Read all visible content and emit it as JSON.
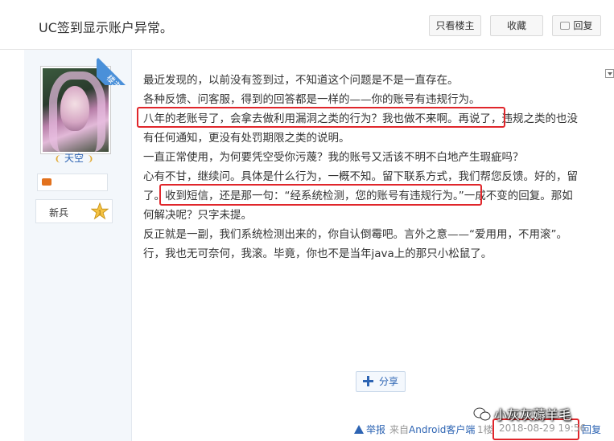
{
  "thread": {
    "title": "UC签到显示账户异常。",
    "buttons": {
      "only_op": "只看楼主",
      "favorite": "收藏",
      "reply": "回复"
    }
  },
  "author": {
    "name": "天空",
    "name_decoration_left": "❨",
    "name_decoration_right": "❩",
    "rank": "新兵",
    "badge": "楼主"
  },
  "post": {
    "lines": [
      "最近发现的，以前没有签到过，不知道这个问题是不是一直存在。",
      "各种反馈、问客服，得到的回答都是一样的——你的账号有违规行为。",
      "八年的老账号了，会拿去做利用漏洞之类的行为？我也做不来啊。再说了，违规之类的也没",
      "有任何通知，更没有处罚期限之类的说明。",
      "一直正常使用，为何要凭空受你污蔑？我的账号又活该不明不白地产生瑕疵吗？",
      "心有不甘，继续问。具体是什么行为，一概不知。留下联系方式，我们帮您反馈。好的，留",
      "了。收到短信，还是那一句：“经系统检测，您的账号有违规行为。”一成不变的回复。那如",
      "何解决呢？只字未提。",
      "反正就是一副，我们系统检测出来的，你自认倒霉吧。言外之意——“爱用用，不用滚”。",
      "行，我也无可奈何，我滚。毕竟，你也不是当年java上的那只小松鼠了。"
    ],
    "share_label": "分享"
  },
  "watermark": {
    "text": "小灰灰薅羊毛"
  },
  "footer": {
    "report": "举报",
    "from_prefix": "来自",
    "client": "Android客户端",
    "floor": "1楼",
    "date": "2018-08-29 19:56",
    "reply": "回复"
  },
  "colors": {
    "link": "#2d64b3",
    "highlight": "#e0262b",
    "badge": "#4a90d9"
  }
}
